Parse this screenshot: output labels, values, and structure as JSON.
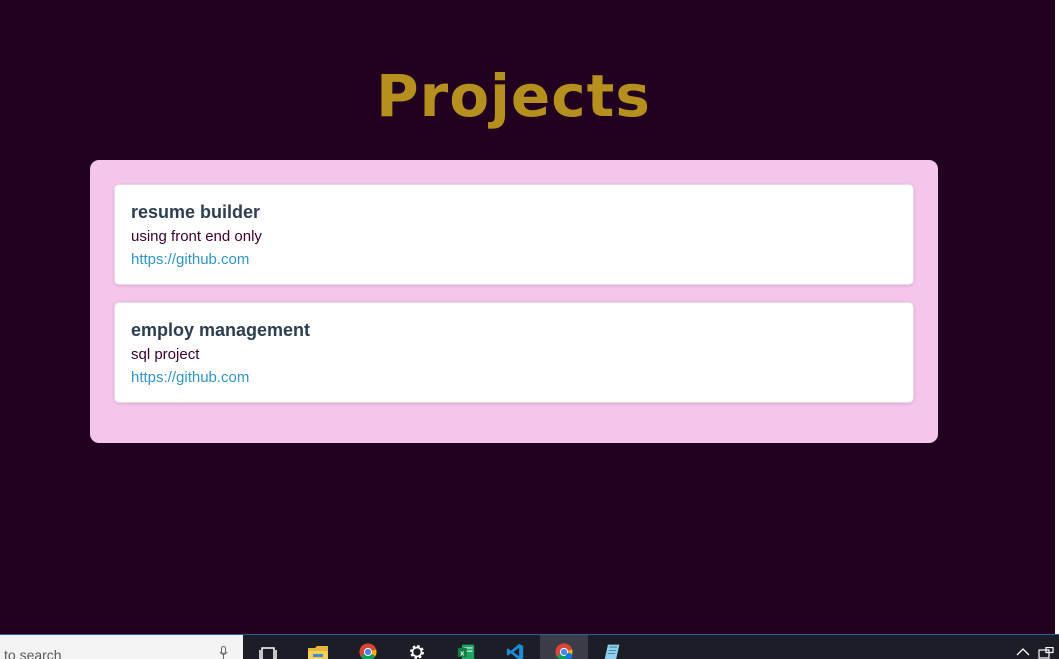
{
  "page": {
    "title": "Projects"
  },
  "projects": [
    {
      "name": "resume builder",
      "description": "using front end only",
      "link": "https://github.com"
    },
    {
      "name": "employ management",
      "description": "sql project",
      "link": "https://github.com"
    }
  ],
  "taskbar": {
    "search_placeholder": "to search",
    "icons": [
      "task-view-icon",
      "file-explorer-icon",
      "chrome-icon",
      "settings-icon",
      "excel-icon",
      "vscode-icon",
      "chrome-profile-icon",
      "notepad-icon"
    ],
    "tray_icons": [
      "chevron-up-icon",
      "network-icon"
    ]
  },
  "colors": {
    "background": "#220020",
    "title": "#b6901f",
    "panel": "#f4c6ec",
    "card": "#ffffff",
    "project_name": "#2c3e50",
    "description": "#3a0030",
    "link": "#3196c7"
  }
}
